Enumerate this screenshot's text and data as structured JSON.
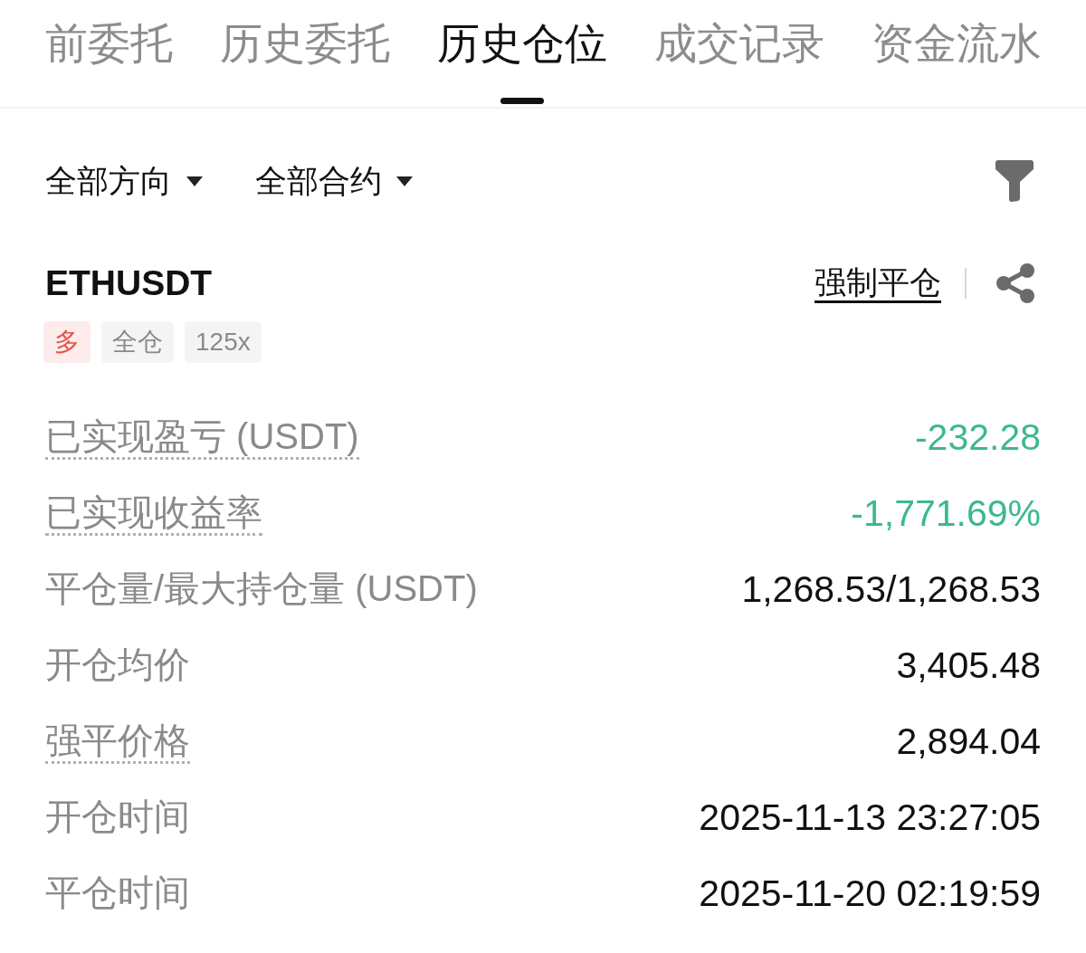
{
  "tabs": [
    {
      "label": "前委托",
      "selected": false
    },
    {
      "label": "历史委托",
      "selected": false
    },
    {
      "label": "历史仓位",
      "selected": true
    },
    {
      "label": "成交记录",
      "selected": false
    },
    {
      "label": "资金流水",
      "selected": false
    }
  ],
  "filters": {
    "dropdowns": [
      "全部方向",
      "全部合约"
    ]
  },
  "position": {
    "symbol": "ETHUSDT",
    "close_type": "强制平仓",
    "tags": [
      {
        "label": "多",
        "kind": "side"
      },
      {
        "label": "全仓",
        "kind": "plain"
      },
      {
        "label": "125x",
        "kind": "plain"
      }
    ]
  },
  "fields": [
    {
      "label": "已实现盈亏 (USDT)",
      "value": "-232.28",
      "hint": true,
      "loss": true
    },
    {
      "label": "已实现收益率",
      "value": "-1,771.69%",
      "hint": true,
      "loss": true
    },
    {
      "label": "平仓量/最大持仓量 (USDT)",
      "value": "1,268.53/1,268.53",
      "hint": false,
      "loss": false
    },
    {
      "label": "开仓均价",
      "value": "3,405.48",
      "hint": false,
      "loss": false
    },
    {
      "label": "强平价格",
      "value": "2,894.04",
      "hint": true,
      "loss": false
    },
    {
      "label": "开仓时间",
      "value": "2025-11-13 23:27:05",
      "hint": false,
      "loss": false
    },
    {
      "label": "平仓时间",
      "value": "2025-11-20 02:19:59",
      "hint": false,
      "loss": false
    }
  ]
}
